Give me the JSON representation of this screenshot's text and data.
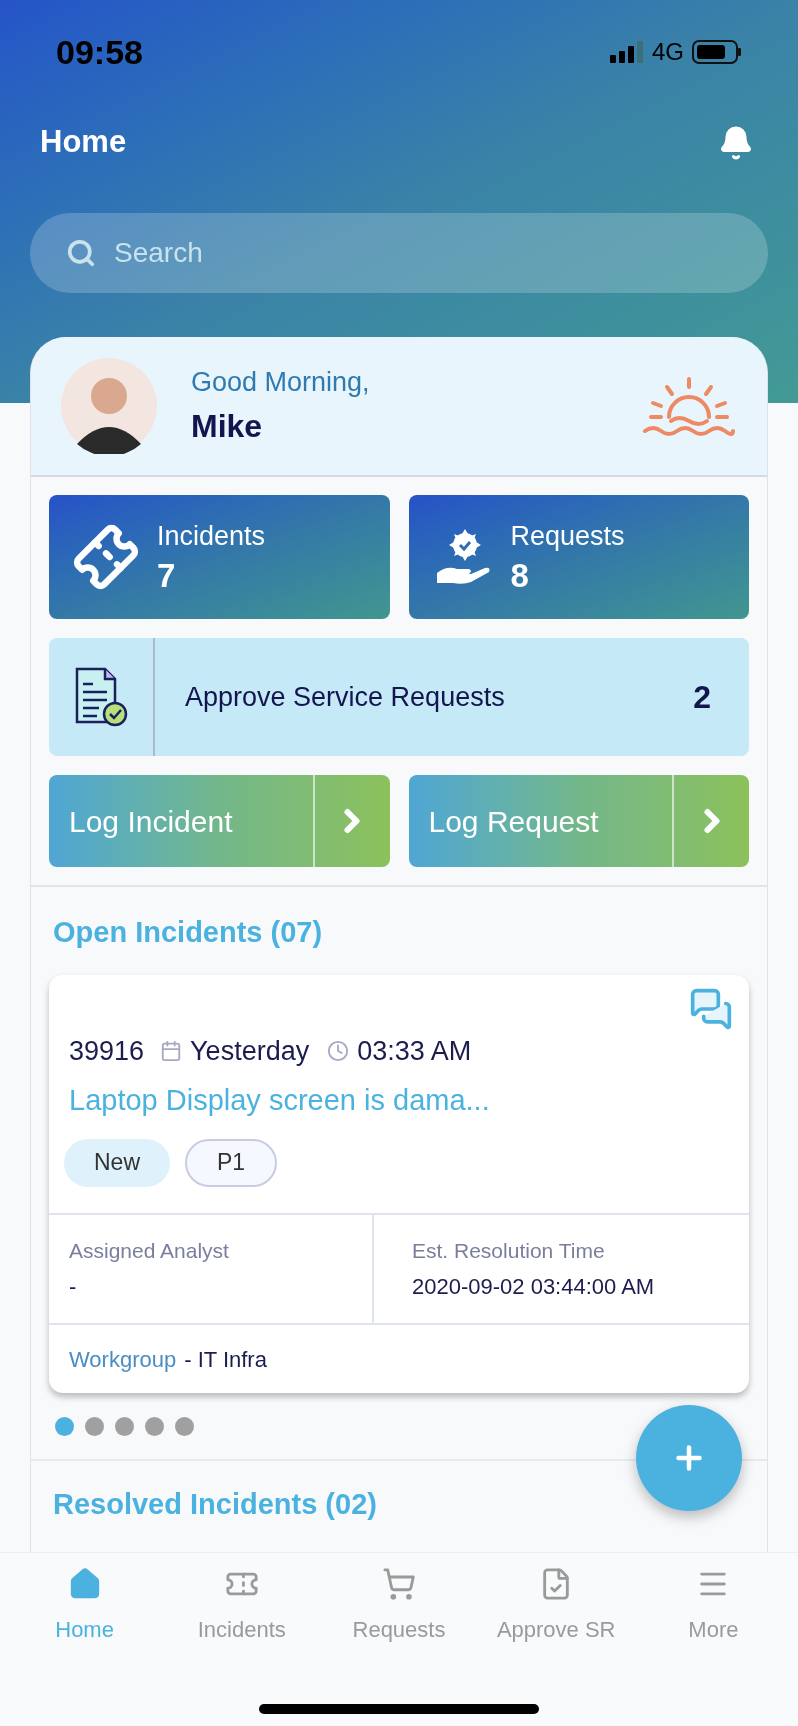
{
  "status_bar": {
    "time": "09:58",
    "network": "4G"
  },
  "header": {
    "title": "Home"
  },
  "search": {
    "placeholder": "Search"
  },
  "greeting": {
    "salutation": "Good Morning,",
    "name": "Mike"
  },
  "tiles": [
    {
      "kind": "ticket",
      "label": "Incidents",
      "count": "7"
    },
    {
      "kind": "service",
      "label": "Requests",
      "count": "8"
    }
  ],
  "approvals": {
    "label": "Approve Service Requests",
    "count": "2"
  },
  "actions": [
    {
      "label": "Log Incident"
    },
    {
      "label": "Log Request"
    }
  ],
  "open_incidents": {
    "title": "Open Incidents (07)",
    "card": {
      "id": "39916",
      "date": "Yesterday",
      "time": "03:33 AM",
      "subject": "Laptop Display screen is dama...",
      "tags": [
        {
          "kind": "status",
          "label": "New"
        },
        {
          "kind": "priority",
          "label": "P1"
        }
      ],
      "analyst_label": "Assigned Analyst",
      "analyst_value": "-",
      "resolution_label": "Est. Resolution Time",
      "resolution_value": "2020-09-02 03:44:00 AM",
      "workgroup_label": "Workgroup",
      "workgroup_value": "- IT Infra"
    },
    "pager": [
      {
        "selected": true
      },
      {
        "selected": false
      },
      {
        "selected": false
      },
      {
        "selected": false
      },
      {
        "selected": false
      }
    ]
  },
  "resolved_incidents": {
    "title": "Resolved Incidents (02)"
  },
  "tab_bar": [
    {
      "kind": "home",
      "label": "Home",
      "selected": true
    },
    {
      "kind": "ticket",
      "label": "Incidents",
      "selected": false
    },
    {
      "kind": "cart",
      "label": "Requests",
      "selected": false
    },
    {
      "kind": "approve",
      "label": "Approve SR",
      "selected": false
    },
    {
      "kind": "menu",
      "label": "More",
      "selected": false
    }
  ]
}
